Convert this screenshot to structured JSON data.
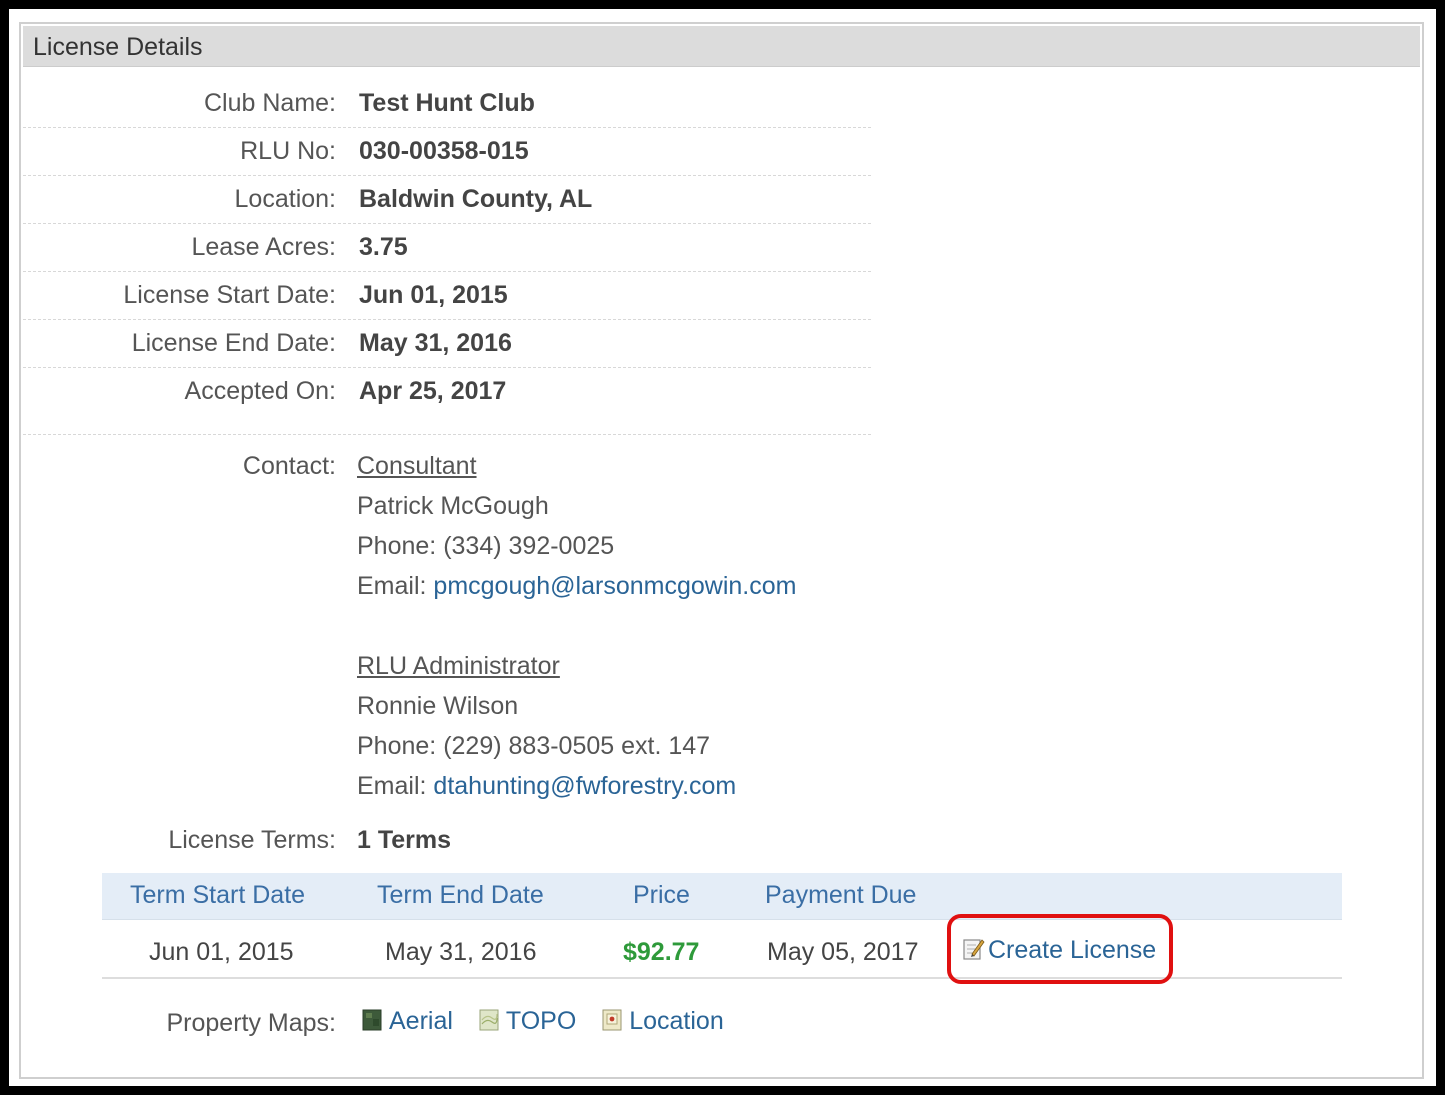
{
  "panel": {
    "title": "License Details"
  },
  "details": [
    {
      "label": "Club Name:",
      "value": "Test Hunt Club"
    },
    {
      "label": "RLU No:",
      "value": "030-00358-015"
    },
    {
      "label": "Location:",
      "value": "Baldwin County, AL"
    },
    {
      "label": "Lease Acres:",
      "value": "3.75"
    },
    {
      "label": "License Start Date:",
      "value": "Jun 01, 2015"
    },
    {
      "label": "License End Date:",
      "value": "May 31, 2016"
    },
    {
      "label": "Accepted On:",
      "value": "Apr 25, 2017"
    }
  ],
  "contact": {
    "label": "Contact:",
    "consultant": {
      "heading": "Consultant",
      "name": "Patrick McGough",
      "phone_label": "Phone:",
      "phone": "(334) 392-0025",
      "email_label": "Email:",
      "email": "pmcgough@larsonmcgowin.com"
    },
    "admin": {
      "heading": "RLU Administrator",
      "name": "Ronnie Wilson",
      "phone_label": "Phone:",
      "phone": "(229) 883-0505 ext. 147",
      "email_label": "Email:",
      "email": "dtahunting@fwforestry.com"
    }
  },
  "license_terms": {
    "label": "License Terms:",
    "value": "1 Terms"
  },
  "terms_table": {
    "headers": [
      "Term Start Date",
      "Term End Date",
      "Price",
      "Payment Due"
    ],
    "rows": [
      {
        "start": "Jun 01, 2015",
        "end": "May 31, 2016",
        "price": "$92.77",
        "due": "May 05, 2017",
        "action": "Create License"
      }
    ]
  },
  "property_maps": {
    "label": "Property Maps:",
    "links": [
      "Aerial",
      "TOPO",
      "Location"
    ]
  },
  "colors": {
    "link": "#2a6496",
    "price": "#2e9a3a",
    "highlight": "#e01010",
    "table_header_bg": "#e4edf7"
  },
  "icons": {
    "create_license": "edit-document-icon",
    "aerial": "aerial-map-icon",
    "topo": "topo-map-icon",
    "location": "location-map-icon"
  }
}
